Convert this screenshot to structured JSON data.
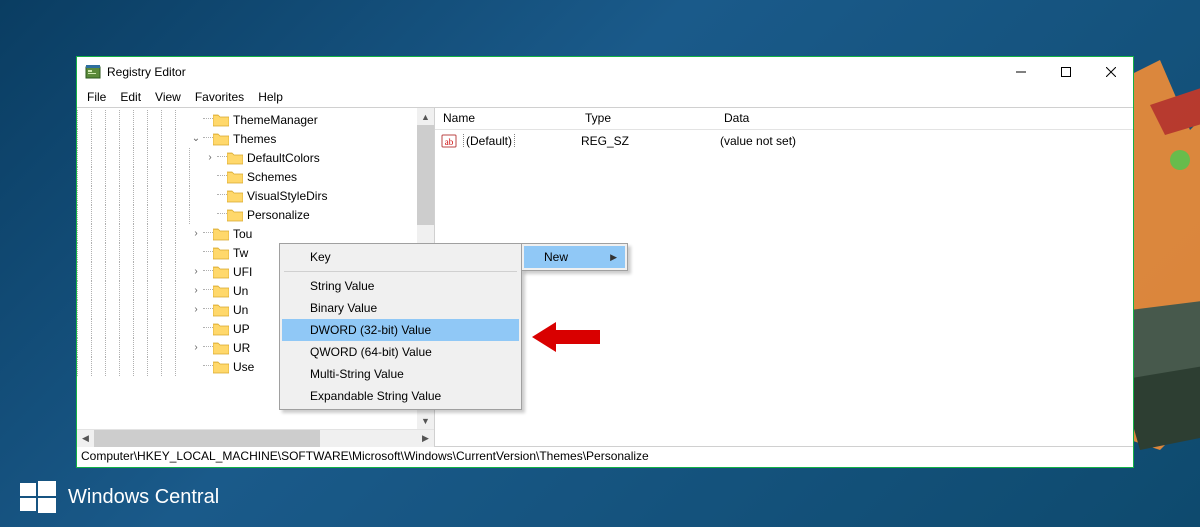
{
  "window": {
    "title": "Registry Editor",
    "controls": {
      "minimize": "Minimize",
      "maximize": "Maximize",
      "close": "Close"
    }
  },
  "menu": {
    "items": [
      "File",
      "Edit",
      "View",
      "Favorites",
      "Help"
    ]
  },
  "tree": [
    {
      "label": "ThemeManager",
      "depth": 8,
      "exp": "none"
    },
    {
      "label": "Themes",
      "depth": 8,
      "exp": "open"
    },
    {
      "label": "DefaultColors",
      "depth": 9,
      "exp": "closed"
    },
    {
      "label": "Schemes",
      "depth": 9,
      "exp": "none"
    },
    {
      "label": "VisualStyleDirs",
      "depth": 9,
      "exp": "none"
    },
    {
      "label": "Personalize",
      "depth": 9,
      "exp": "none"
    },
    {
      "label": "Tou",
      "depth": 8,
      "exp": "closed",
      "trunc": true
    },
    {
      "label": "Tw",
      "depth": 8,
      "exp": "none",
      "trunc": true
    },
    {
      "label": "UFI",
      "depth": 8,
      "exp": "closed",
      "trunc": true
    },
    {
      "label": "Un",
      "depth": 8,
      "exp": "closed",
      "trunc": true
    },
    {
      "label": "Un",
      "depth": 8,
      "exp": "closed",
      "trunc": true
    },
    {
      "label": "UP",
      "depth": 8,
      "exp": "none",
      "trunc": true
    },
    {
      "label": "UR",
      "depth": 8,
      "exp": "closed",
      "trunc": true
    },
    {
      "label": "Use",
      "depth": 8,
      "exp": "none",
      "trunc": true
    }
  ],
  "list": {
    "columns": [
      "Name",
      "Type",
      "Data"
    ],
    "rows": [
      {
        "name": "(Default)",
        "type": "REG_SZ",
        "data": "(value not set)",
        "valueKind": "string"
      }
    ]
  },
  "context_menu_parent": {
    "items": [
      {
        "label": "New",
        "submenu": true,
        "highlight": true
      }
    ]
  },
  "context_menu_sub": {
    "items": [
      {
        "label": "Key"
      },
      {
        "sep": true
      },
      {
        "label": "String Value"
      },
      {
        "label": "Binary Value"
      },
      {
        "label": "DWORD (32-bit) Value",
        "highlight": true
      },
      {
        "label": "QWORD (64-bit) Value"
      },
      {
        "label": "Multi-String Value"
      },
      {
        "label": "Expandable String Value"
      }
    ]
  },
  "path": "Computer\\HKEY_LOCAL_MACHINE\\SOFTWARE\\Microsoft\\Windows\\CurrentVersion\\Themes\\Personalize",
  "watermark": {
    "text": "Windows Central"
  },
  "colors": {
    "accent": "#13b146",
    "highlight": "#90c8f6"
  }
}
